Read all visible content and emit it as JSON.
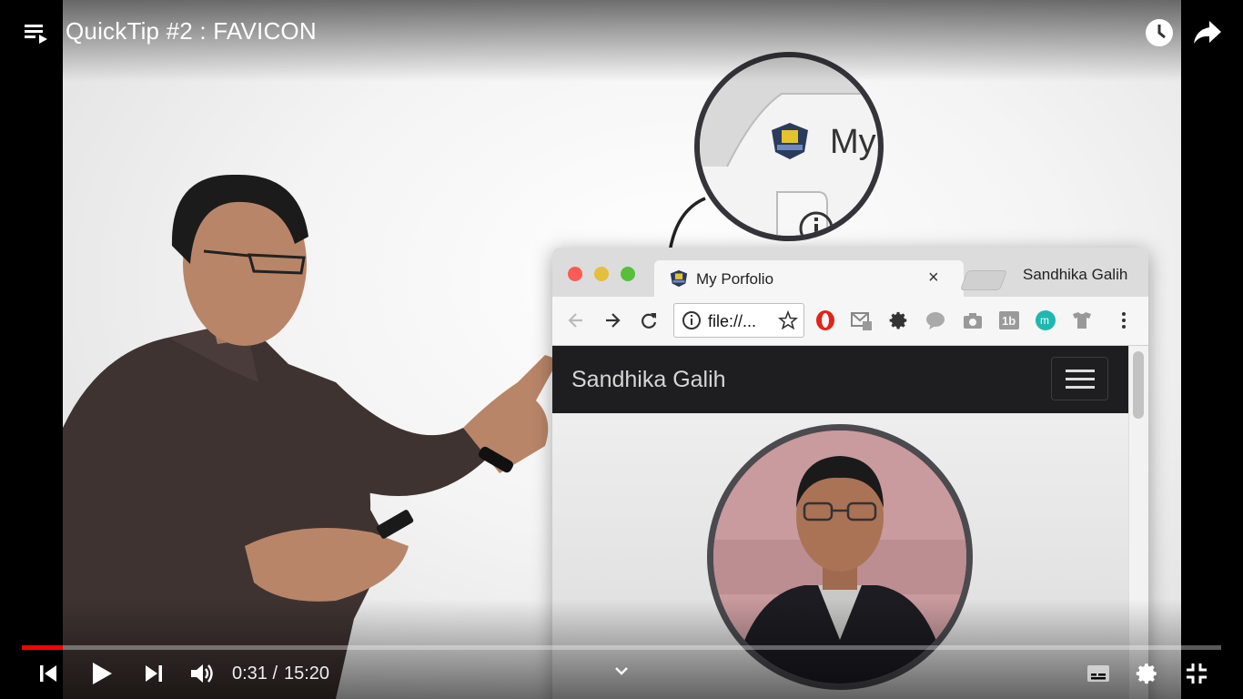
{
  "player": {
    "title": "QuickTip #2 : FAVICON",
    "progress_fraction": 0.0034,
    "time_current": "0:31",
    "time_separator": " / ",
    "time_total": "15:20",
    "icons": {
      "playlist": "playlist-icon",
      "watch_later": "clock-icon",
      "share": "share-arrow-icon",
      "previous": "skip-previous-icon",
      "play": "play-icon",
      "next": "skip-next-icon",
      "volume": "volume-icon",
      "chevron": "chevron-down-icon",
      "subtitles": "subtitles-icon",
      "settings": "gear-icon",
      "exit_fullscreen": "exit-fullscreen-icon"
    },
    "colors": {
      "progress": "#ff0000",
      "title": "#ffffff"
    }
  },
  "video_scene": {
    "magnifier_label": "My",
    "browser": {
      "tab_title": "My Porfolio",
      "tab_close": "×",
      "profile_name": "Sandhika Galih",
      "url": "file://...",
      "navbar_brand": "Sandhika Galih",
      "extension_icons": [
        "opera-icon",
        "gmail-checker-icon",
        "gear-icon",
        "speech-bubble-icon",
        "camera-icon",
        "1b-icon",
        "m-icon",
        "tshirt-icon",
        "more-vertical-icon"
      ]
    }
  }
}
